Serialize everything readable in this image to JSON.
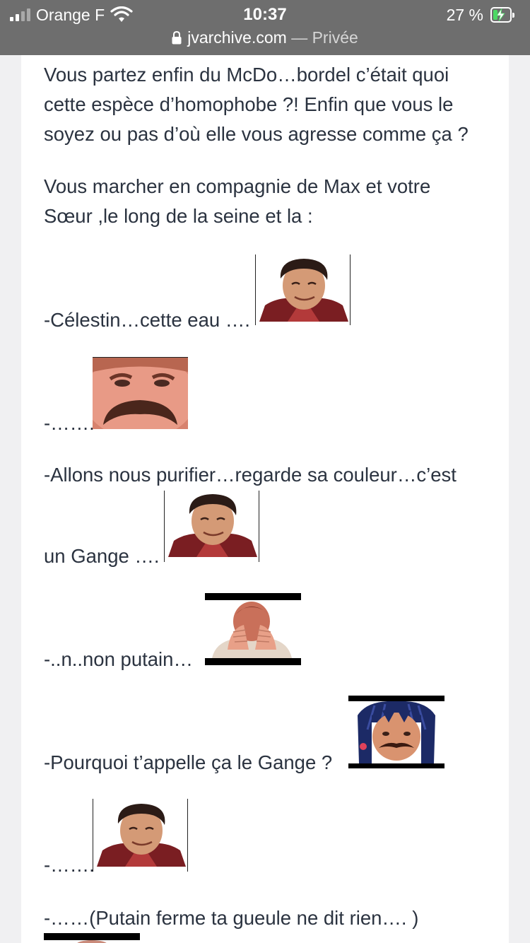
{
  "status_bar": {
    "carrier": "Orange F",
    "time": "10:37",
    "battery": "27 %",
    "battery_level": 0.27
  },
  "address_bar": {
    "domain": "jvarchive.com",
    "separator": " — ",
    "mode": "Privée"
  },
  "post": {
    "paragraphs": [
      "Vous partez enfin du McDo…bordel c’était quoi cette espèce d’homophobe ?! Enfin que vous le soyez ou pas d’où elle vous agresse comme ça ?",
      "Vous marcher en compagnie de Max et votre Sœur ,le long de la seine et la :"
    ],
    "lines": [
      "-Célestin…cette eau ….",
      "-…….",
      "-Allons nous purifier…regarde sa couleur…c’est",
      "un Gange ….",
      "-..n..non putain…",
      "-Pourquoi t’appelle ça le Gange ?",
      "-…….",
      "-……(Putain ferme ta gueule ne dit rien…. )"
    ],
    "stickers": [
      "smiling-man-sticker",
      "mustache-man-sticker",
      "smiling-man-sticker",
      "facepalm-sticker",
      "anime-hair-mustache-sticker",
      "smiling-man-sticker"
    ]
  }
}
